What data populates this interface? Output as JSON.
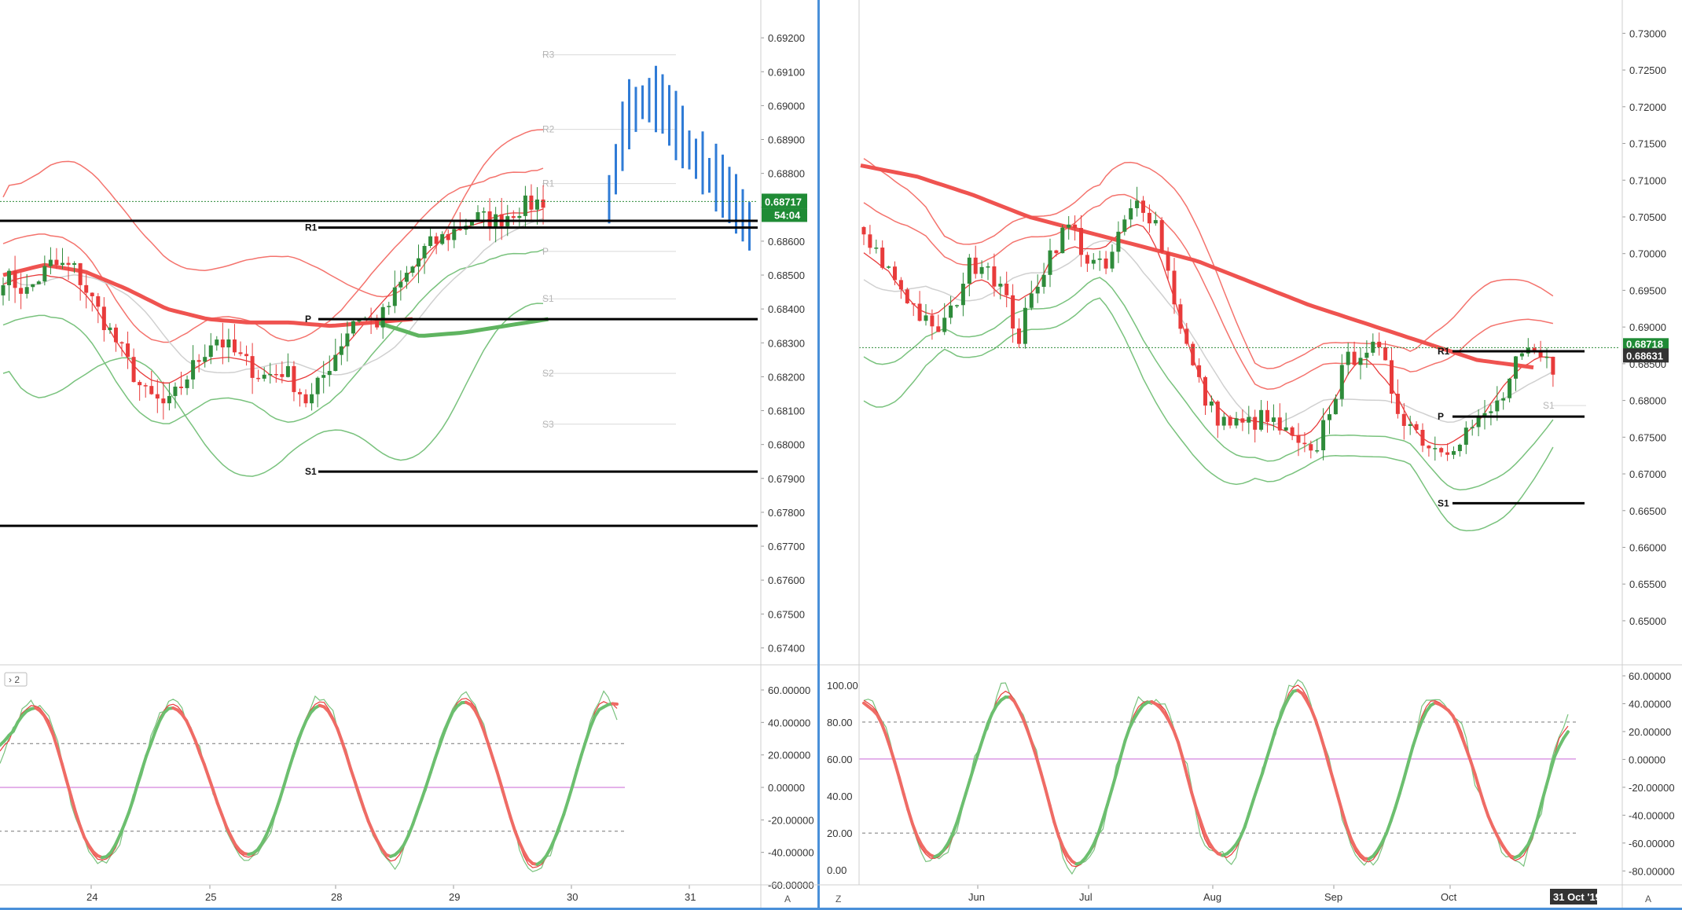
{
  "chart_data": [
    {
      "type": "candlestick",
      "timeframe_hint": "intraday",
      "x_ticks": [
        "24",
        "25",
        "28",
        "29",
        "30",
        "31"
      ],
      "ylim": [
        0.6735,
        0.693
      ],
      "y_ticks": [
        "0.69200",
        "0.69100",
        "0.69000",
        "0.68900",
        "0.68800",
        "0.68700",
        "0.68600",
        "0.68500",
        "0.68400",
        "0.68300",
        "0.68200",
        "0.68100",
        "0.68000",
        "0.67900",
        "0.67800",
        "0.67700",
        "0.67600",
        "0.67500",
        "0.67400"
      ],
      "price_badge": "0.68717",
      "countdown_badge": "54:04",
      "last_price": 0.68717,
      "pivot_lines": [
        {
          "label": "R1",
          "value": 0.6864
        },
        {
          "label": "P",
          "value": 0.6837
        },
        {
          "label": "S1",
          "value": 0.6792
        },
        {
          "label": "",
          "value": 0.6776
        },
        {
          "label": "",
          "value": 0.6866
        }
      ],
      "ghost_levels": [
        {
          "label": "R3",
          "value": 0.6915
        },
        {
          "label": "R2",
          "value": 0.6893
        },
        {
          "label": "R1",
          "value": 0.6877
        },
        {
          "label": "P",
          "value": 0.6857
        },
        {
          "label": "S1",
          "value": 0.6843
        },
        {
          "label": "S2",
          "value": 0.6821
        },
        {
          "label": "S3",
          "value": 0.6806
        }
      ],
      "indicator": {
        "ylim": [
          -60,
          60
        ],
        "y_ticks": [
          "60.00000",
          "40.00000",
          "20.00000",
          "0.00000",
          "-20.00000",
          "-40.00000",
          "-60.00000"
        ],
        "levels": [
          27,
          0,
          -27
        ],
        "collapse_label": "2"
      },
      "axis_corner_label": "A"
    },
    {
      "type": "candlestick",
      "timeframe_hint": "daily",
      "x_ticks": [
        "Jun",
        "Jul",
        "Aug",
        "Sep",
        "Oct"
      ],
      "x_cursor_label": "31 Oct '19",
      "ylim": [
        0.644,
        0.734
      ],
      "y_ticks": [
        "0.73000",
        "0.72500",
        "0.72000",
        "0.71500",
        "0.71000",
        "0.70500",
        "0.70000",
        "0.69500",
        "0.69000",
        "0.68500",
        "0.68000",
        "0.67500",
        "0.67000",
        "0.66500",
        "0.66000",
        "0.65500",
        "0.65000"
      ],
      "price_badge_top": "0.68718",
      "price_badge": "0.68631",
      "last_price": 0.6872,
      "pivot_lines": [
        {
          "label": "R1",
          "value": 0.6867
        },
        {
          "label": "P",
          "value": 0.6778
        },
        {
          "label": "S1",
          "value": 0.666
        }
      ],
      "ghost_levels": [
        {
          "label": "S1",
          "value": 0.6793
        }
      ],
      "indicator": {
        "ylim_left": [
          -8,
          105
        ],
        "y_ticks_left": [
          "100.00",
          "80.00",
          "60.00",
          "40.00",
          "20.00",
          "0.00"
        ],
        "ylim_right": [
          -90,
          60
        ],
        "y_ticks_right": [
          "60.00000",
          "40.00000",
          "20.00000",
          "0.00000",
          "-20.00000",
          "-40.00000",
          "-60.00000",
          "-80.00000"
        ],
        "levels_left": [
          80,
          60,
          20
        ]
      },
      "axis_corner_left": "Z",
      "axis_corner_label": "A"
    }
  ],
  "colors": {
    "up": "#2e8b3a",
    "down": "#e83b3b",
    "ma_red": "#ef5350",
    "band_red": "#f4736d",
    "band_green": "#79c27d",
    "ma_grey": "#d0d0d0",
    "blue_bars": "#2f7bd6",
    "badge_green": "#1f8b35",
    "badge_dark": "#333333",
    "divider_blue": "#4a90d9",
    "level_purple": "#c966d6"
  }
}
